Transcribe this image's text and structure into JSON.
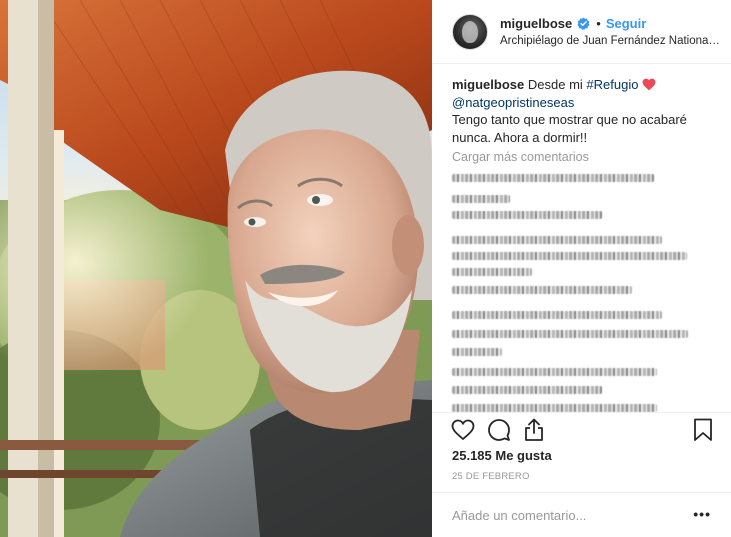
{
  "post": {
    "photo": {
      "icon": "photo-portrait"
    },
    "header": {
      "username": "miguelbose",
      "verified_icon": "verified-badge-icon",
      "separator": "•",
      "follow_label": "Seguir",
      "location": "Archipiélago de Juan Fernández National Park"
    },
    "caption": {
      "username": "miguelbose",
      "text_before": "Desde mi",
      "hashtag": "#Refugio",
      "mention": "@natgeopristineseas",
      "text_after": "Tengo tanto que mostrar que no acabaré nunca. Ahora a dormir!!"
    },
    "load_more_label": "Cargar más comentarios",
    "likes_label": "25.185 Me gusta",
    "date_label": "25 de febrero",
    "add_comment_placeholder": "Añade un comentario...",
    "more_label": "•••",
    "colors": {
      "link": "#3897f0",
      "heart": "#ed4956",
      "muted": "#999999",
      "text": "#262626"
    }
  }
}
